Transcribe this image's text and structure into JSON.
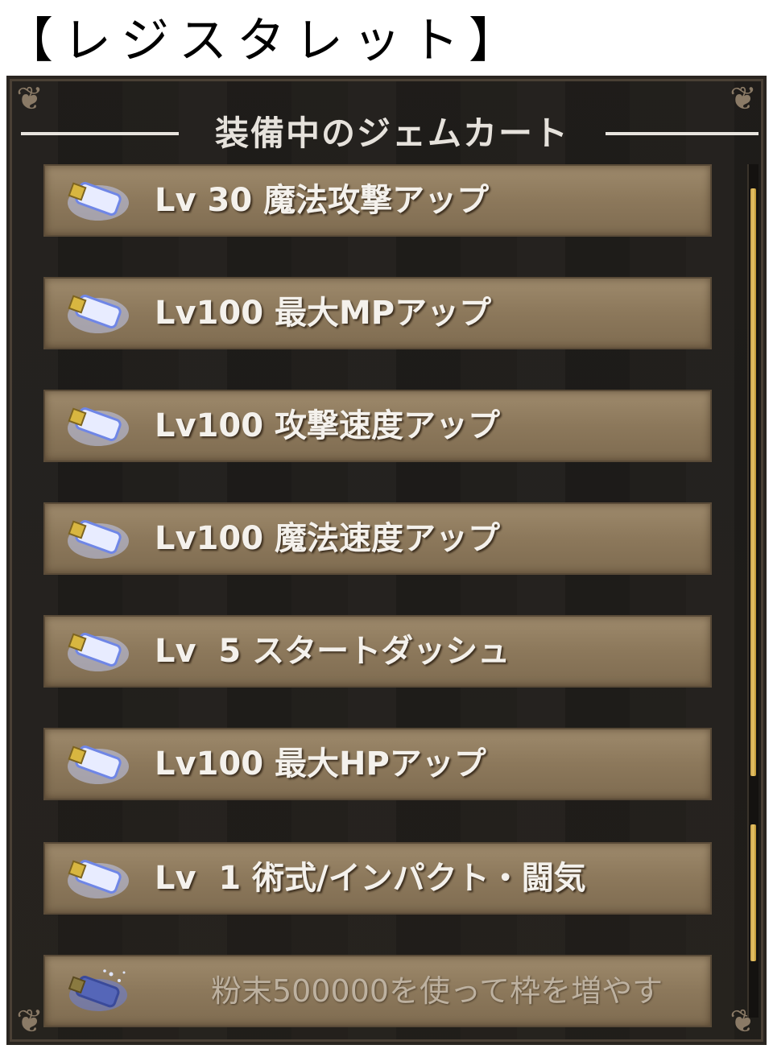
{
  "page_title": "【レジスタレット】",
  "panel": {
    "title": "装備中のジェムカート",
    "gems": [
      {
        "label": "Lv 30 魔法攻撃アップ"
      },
      {
        "label": "Lv100 最大MPアップ"
      },
      {
        "label": "Lv100 攻撃速度アップ"
      },
      {
        "label": "Lv100 魔法速度アップ"
      },
      {
        "label": "Lv  5 スタートダッシュ"
      },
      {
        "label": "Lv100 最大HPアップ"
      },
      {
        "label": "Lv  1 術式/インパクト・闘気"
      }
    ],
    "add_slot": {
      "label": "粉末500000を使って枠を増やす"
    }
  },
  "colors": {
    "slot_fill": "#8c785b",
    "text": "#f4f1ec",
    "gem_glow": "#9fb2ff",
    "scroll_thumb": "#e6c468"
  }
}
